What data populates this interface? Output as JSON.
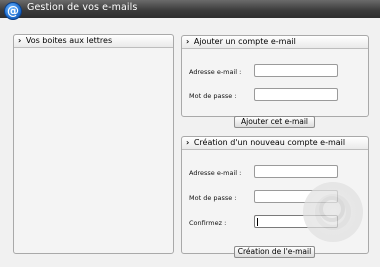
{
  "window": {
    "title": "Gestion de vos e-mails",
    "icon": "at-sign-icon",
    "icon_glyph": "@"
  },
  "mailboxes": {
    "header": "Vos boites aux lettres",
    "items": []
  },
  "add_account": {
    "header": "Ajouter un compte e-mail",
    "email_label": "Adresse e-mail :",
    "email_value": "",
    "password_label": "Mot de passe :",
    "password_value": "",
    "submit_label": "Ajouter cet e-mail"
  },
  "create_account": {
    "header": "Création d'un nouveau compte e-mail",
    "email_label": "Adresse e-mail :",
    "email_value": "",
    "password_label": "Mot de passe :",
    "password_value": "",
    "confirm_label": "Confirmez :",
    "confirm_value": "",
    "submit_label": "Création de l'e-mail"
  },
  "chevron_glyph": "›",
  "colors": {
    "titlebar": "#3a3a3a",
    "icon_blue": "#1f6fd0",
    "panel_border": "#a9a9a9",
    "background": "#f1f1f1"
  }
}
